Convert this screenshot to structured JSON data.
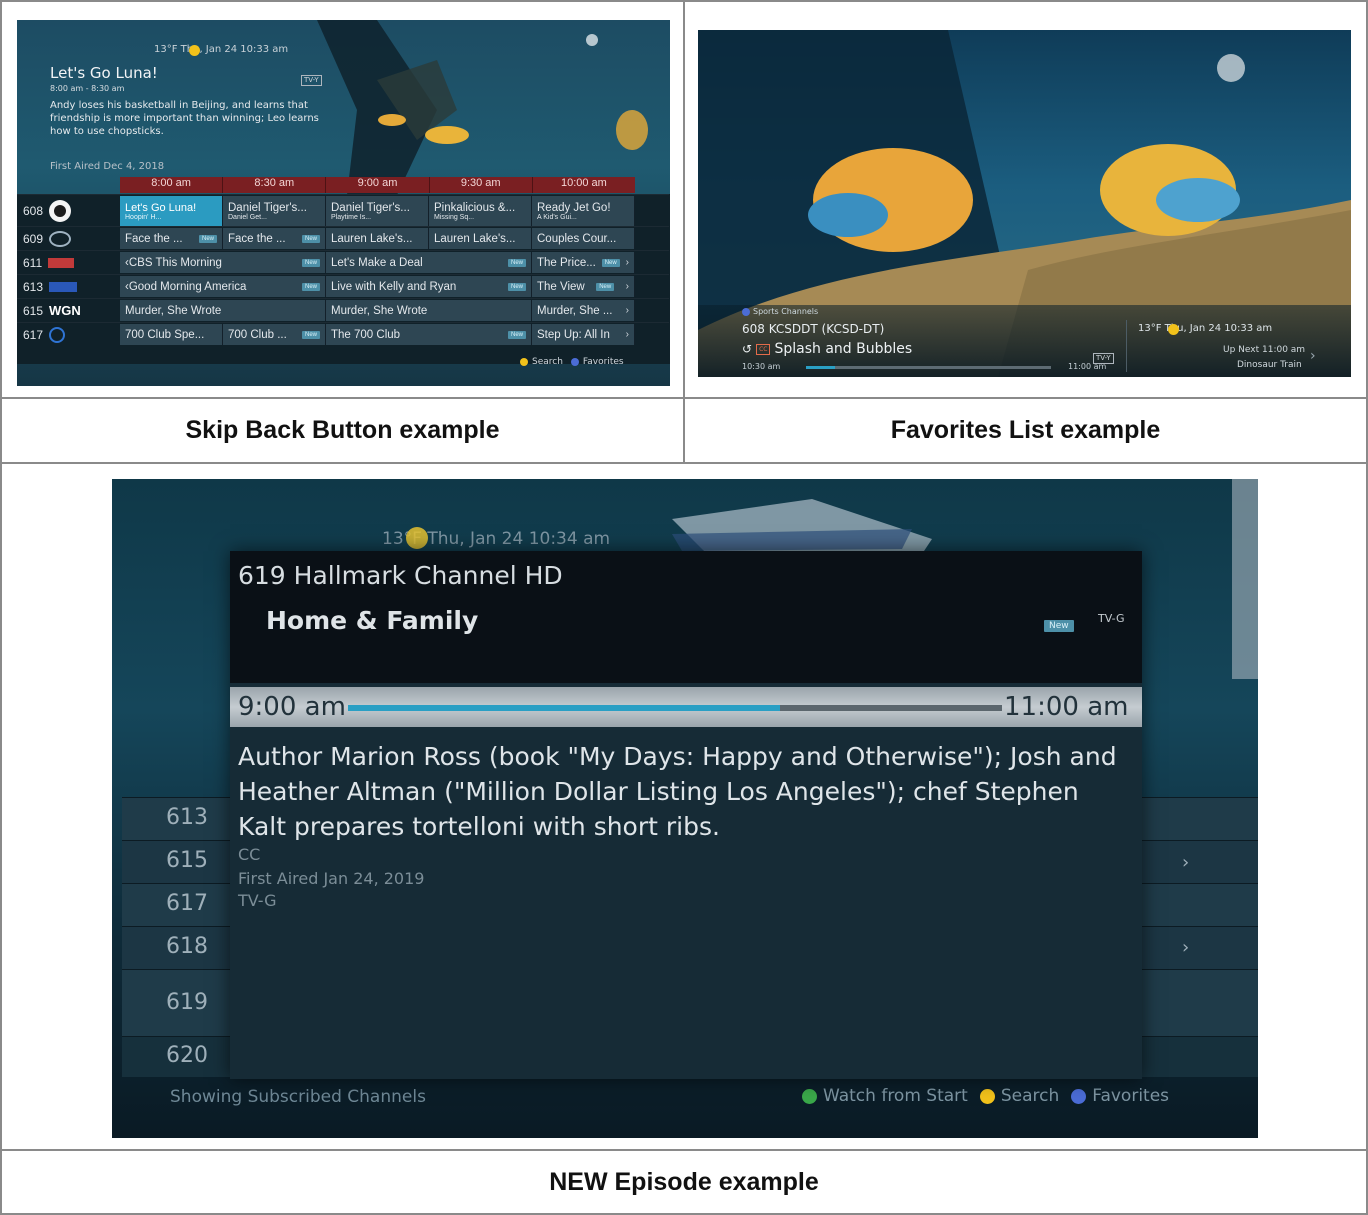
{
  "captions": {
    "skip_back": "Skip Back Button example",
    "favorites": "Favorites List example",
    "new_episode": "NEW Episode example"
  },
  "skip_back_screen": {
    "weather_time": "13°F  Thu, Jan 24 10:33 am",
    "show_title": "Let's Go Luna!",
    "rating": "TV-Y",
    "time_range": "8:00 am - 8:30 am",
    "description": "Andy loses his basketball in Beijing, and learns that friendship is more important than winning; Leo learns how to use chopsticks.",
    "first_aired": "First Aired Dec 4, 2018",
    "time_slots": [
      "8:00 am",
      "8:30 am",
      "9:00 am",
      "9:30 am",
      "10:00 am"
    ],
    "rows": [
      {
        "channel": "608",
        "logo": "PBS",
        "cells": [
          "Let's Go Luna!",
          "Daniel Tiger's...",
          "Daniel Tiger's...",
          "Pinkalicious &...",
          "Ready Jet Go!"
        ],
        "subs": [
          "Hoopin' H...",
          "Daniel Get...",
          "Playtime Is...",
          "Missing Sq...",
          "A Kid's Gui..."
        ]
      },
      {
        "channel": "609",
        "logo": "CBS",
        "cells": [
          "Face the ...",
          "Face the ...",
          "Lauren Lake's...",
          "Lauren Lake's...",
          "Couples Cour..."
        ]
      },
      {
        "channel": "611",
        "logo": "KDLT",
        "cells": [
          "CBS This Morning",
          "Let's Make a Deal",
          "The Price..."
        ]
      },
      {
        "channel": "613",
        "logo": "KSFY",
        "cells": [
          "Good Morning America",
          "Live with Kelly and Ryan",
          "The View"
        ]
      },
      {
        "channel": "615",
        "logo": "WGN",
        "cells": [
          "Murder, She Wrote",
          "Murder, She Wrote",
          "Murder, She ..."
        ]
      },
      {
        "channel": "617",
        "logo": "Q",
        "cells": [
          "700 Club Spe...",
          "700 Club ...",
          "The 700 Club",
          "Step Up: All In"
        ]
      }
    ],
    "new_label": "New",
    "legend_search": "Search",
    "legend_favorites": "Favorites"
  },
  "favorites_screen": {
    "favorites_list": "Sports Channels",
    "channel": "608 KCSDDT (KCSD-DT)",
    "show": "Splash and Bubbles",
    "cc": "CC",
    "rating": "TV-Y",
    "start": "10:30 am",
    "end": "11:00 am",
    "progress": 0.12,
    "weather_time": "13°F  Thu, Jan 24 10:33 am",
    "up_next_time": "Up Next 11:00 am",
    "up_next_show": "Dinosaur Train"
  },
  "new_episode_screen": {
    "weather_time": "13°F  Thu, Jan 24 10:34 am",
    "channel_title": "619 Hallmark Channel HD",
    "show_title": "Home & Family",
    "new_label": "New",
    "rating": "TV-G",
    "start": "9:00 am",
    "end": "11:00 am",
    "progress": 0.66,
    "description": "Author Marion Ross (book \"My Days: Happy and Otherwise\"); Josh and Heather Altman (\"Million Dollar Listing Los Angeles\"); chef Stephen Kalt prepares tortelloni with short ribs.",
    "cc": "CC",
    "first_aired": "First Aired Jan 24, 2019",
    "rating_line": "TV-G",
    "bg_channels": [
      "613",
      "615",
      "617",
      "618",
      "619",
      "620"
    ],
    "bottom_left": "Showing Subscribed Channels",
    "legend_watch": "Watch from Start",
    "legend_search": "Search",
    "legend_favorites": "Favorites"
  },
  "colors": {
    "green": "#3aa84a",
    "yellow": "#f2c21b",
    "blue": "#4b6cd6",
    "accent": "#2a9fc4"
  }
}
